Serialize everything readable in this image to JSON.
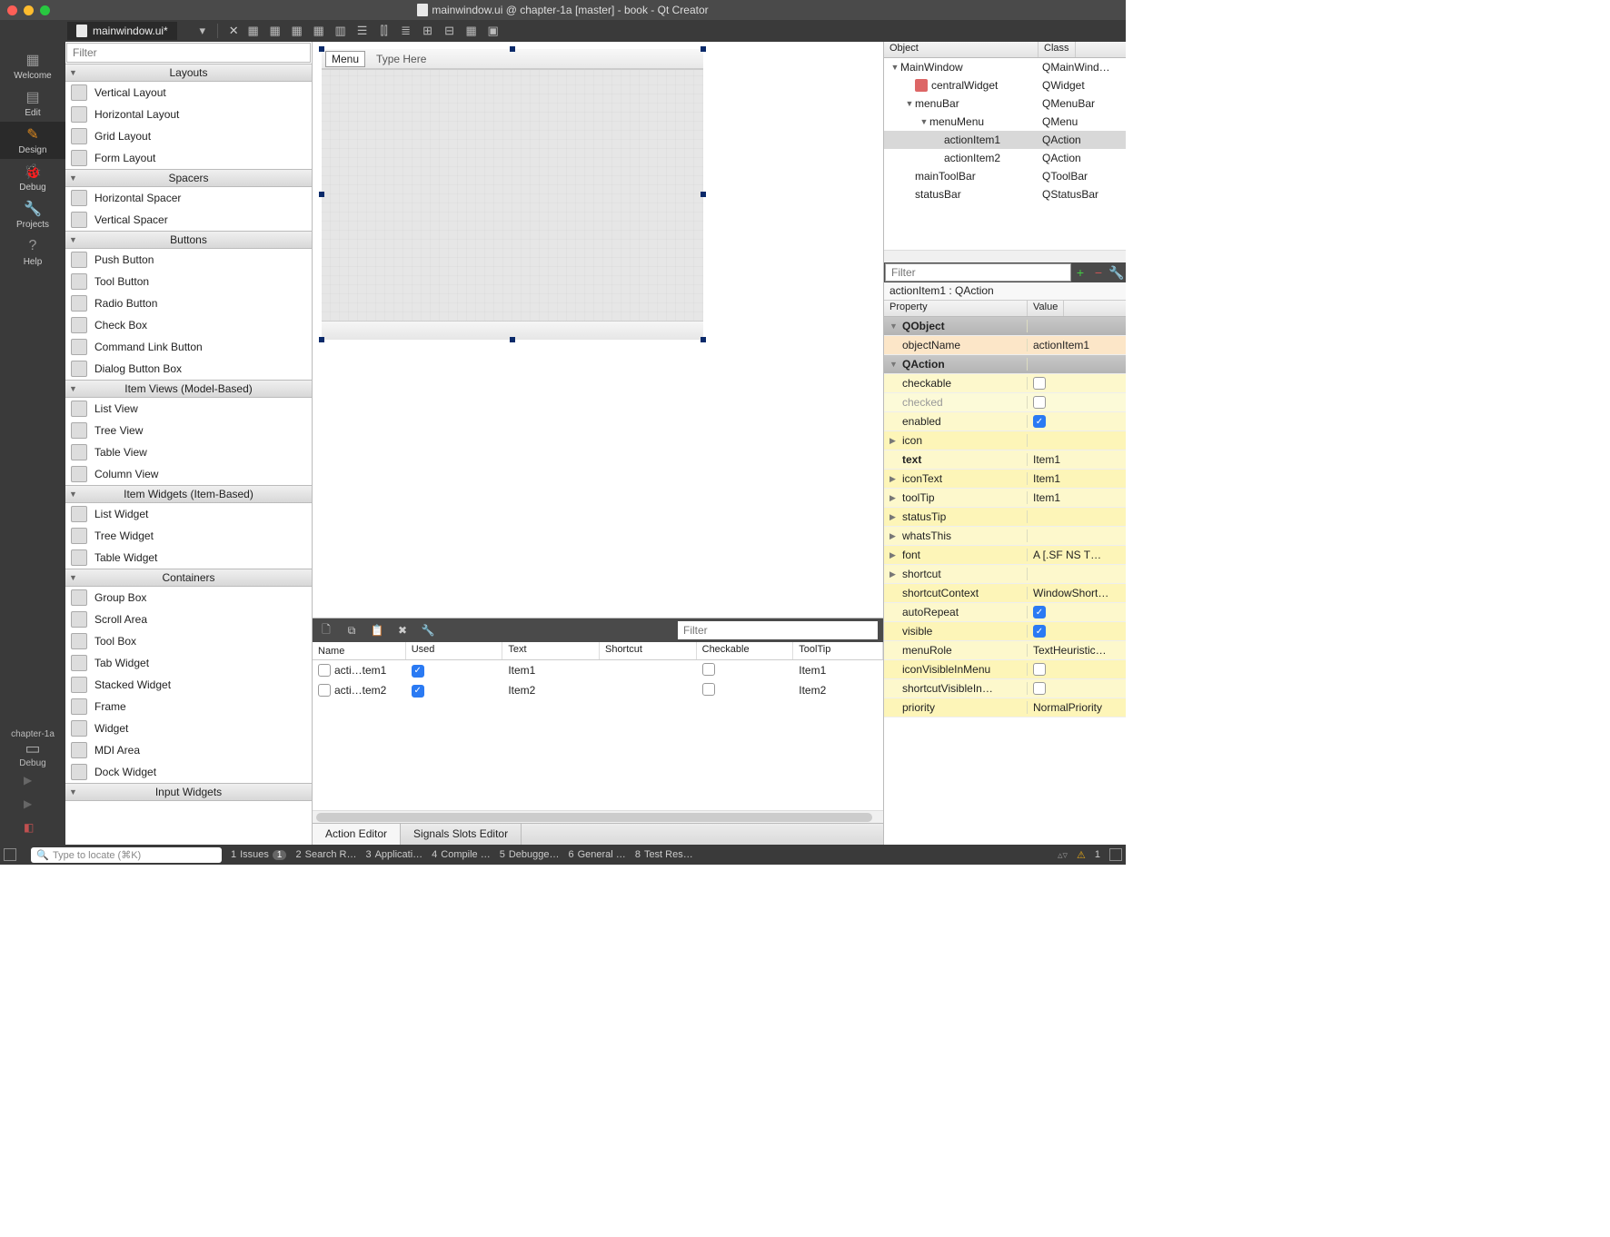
{
  "titlebar": {
    "title": "mainwindow.ui @ chapter-1a [master] - book - Qt Creator"
  },
  "tab": {
    "filename": "mainwindow.ui*"
  },
  "leftbar": {
    "items": [
      {
        "label": "Welcome"
      },
      {
        "label": "Edit"
      },
      {
        "label": "Design"
      },
      {
        "label": "Debug"
      },
      {
        "label": "Projects"
      },
      {
        "label": "Help"
      }
    ],
    "kit": "chapter-1a",
    "kit_mode": "Debug"
  },
  "widgetbox": {
    "filter_placeholder": "Filter",
    "groups": [
      {
        "title": "Layouts",
        "items": [
          "Vertical Layout",
          "Horizontal Layout",
          "Grid Layout",
          "Form Layout"
        ]
      },
      {
        "title": "Spacers",
        "items": [
          "Horizontal Spacer",
          "Vertical Spacer"
        ]
      },
      {
        "title": "Buttons",
        "items": [
          "Push Button",
          "Tool Button",
          "Radio Button",
          "Check Box",
          "Command Link Button",
          "Dialog Button Box"
        ]
      },
      {
        "title": "Item Views (Model-Based)",
        "items": [
          "List View",
          "Tree View",
          "Table View",
          "Column View"
        ]
      },
      {
        "title": "Item Widgets (Item-Based)",
        "items": [
          "List Widget",
          "Tree Widget",
          "Table Widget"
        ]
      },
      {
        "title": "Containers",
        "items": [
          "Group Box",
          "Scroll Area",
          "Tool Box",
          "Tab Widget",
          "Stacked Widget",
          "Frame",
          "Widget",
          "MDI Area",
          "Dock Widget"
        ]
      },
      {
        "title": "Input Widgets",
        "items": []
      }
    ]
  },
  "form": {
    "menu_label": "Menu",
    "type_here": "Type Here"
  },
  "actions": {
    "filter_placeholder": "Filter",
    "columns": [
      "Name",
      "Used",
      "Text",
      "Shortcut",
      "Checkable",
      "ToolTip"
    ],
    "rows": [
      {
        "name": "acti…tem1",
        "used": true,
        "text": "Item1",
        "shortcut": "",
        "checkable": false,
        "tooltip": "Item1"
      },
      {
        "name": "acti…tem2",
        "used": true,
        "text": "Item2",
        "shortcut": "",
        "checkable": false,
        "tooltip": "Item2"
      }
    ],
    "tabs": [
      "Action Editor",
      "Signals  Slots Editor"
    ]
  },
  "object_tree": {
    "columns": [
      "Object",
      "Class"
    ],
    "rows": [
      {
        "indent": 0,
        "exp": "▼",
        "name": "MainWindow",
        "cls": "QMainWind…"
      },
      {
        "indent": 1,
        "exp": "",
        "name": "centralWidget",
        "cls": "QWidget",
        "icon": true
      },
      {
        "indent": 1,
        "exp": "▼",
        "name": "menuBar",
        "cls": "QMenuBar"
      },
      {
        "indent": 2,
        "exp": "▼",
        "name": "menuMenu",
        "cls": "QMenu"
      },
      {
        "indent": 3,
        "exp": "",
        "name": "actionItem1",
        "cls": "QAction",
        "sel": true
      },
      {
        "indent": 3,
        "exp": "",
        "name": "actionItem2",
        "cls": "QAction"
      },
      {
        "indent": 1,
        "exp": "",
        "name": "mainToolBar",
        "cls": "QToolBar"
      },
      {
        "indent": 1,
        "exp": "",
        "name": "statusBar",
        "cls": "QStatusBar"
      }
    ]
  },
  "properties": {
    "filter_placeholder": "Filter",
    "selection": "actionItem1 : QAction",
    "columns": [
      "Property",
      "Value"
    ],
    "rows": [
      {
        "section": true,
        "label": "QObject"
      },
      {
        "prop": "objectName",
        "val": "actionItem1",
        "cls": "orng"
      },
      {
        "section": true,
        "label": "QAction"
      },
      {
        "prop": "checkable",
        "val_chk": false,
        "cls": "ylw"
      },
      {
        "prop": "checked",
        "val_chk": false,
        "cls": "dim"
      },
      {
        "prop": "enabled",
        "val_chk": true,
        "cls": "ylw"
      },
      {
        "prop": "icon",
        "val": "",
        "cls": "ylw2",
        "exp": true
      },
      {
        "prop": "text",
        "val": "Item1",
        "cls": "ylw",
        "bold": true
      },
      {
        "prop": "iconText",
        "val": "Item1",
        "cls": "ylw2",
        "exp": true
      },
      {
        "prop": "toolTip",
        "val": "Item1",
        "cls": "ylw",
        "exp": true
      },
      {
        "prop": "statusTip",
        "val": "",
        "cls": "ylw2",
        "exp": true
      },
      {
        "prop": "whatsThis",
        "val": "",
        "cls": "ylw",
        "exp": true
      },
      {
        "prop": "font",
        "val": "A   [.SF NS T…",
        "cls": "ylw2",
        "exp": true
      },
      {
        "prop": "shortcut",
        "val": "",
        "cls": "ylw",
        "exp": true
      },
      {
        "prop": "shortcutContext",
        "val": "WindowShort…",
        "cls": "ylw2"
      },
      {
        "prop": "autoRepeat",
        "val_chk": true,
        "cls": "ylw"
      },
      {
        "prop": "visible",
        "val_chk": true,
        "cls": "ylw2"
      },
      {
        "prop": "menuRole",
        "val": "TextHeuristic…",
        "cls": "ylw"
      },
      {
        "prop": "iconVisibleInMenu",
        "val_chk": false,
        "cls": "ylw2"
      },
      {
        "prop": "shortcutVisibleIn…",
        "val_chk": false,
        "cls": "ylw"
      },
      {
        "prop": "priority",
        "val": "NormalPriority",
        "cls": "ylw2"
      }
    ]
  },
  "statusbar": {
    "locate_placeholder": "Type to locate (⌘K)",
    "items": [
      {
        "n": "1",
        "label": "Issues",
        "badge": "1"
      },
      {
        "n": "2",
        "label": "Search R…"
      },
      {
        "n": "3",
        "label": "Applicati…"
      },
      {
        "n": "4",
        "label": "Compile …"
      },
      {
        "n": "5",
        "label": "Debugge…"
      },
      {
        "n": "6",
        "label": "General …"
      },
      {
        "n": "8",
        "label": "Test Res…"
      }
    ],
    "warn_count": "1"
  }
}
